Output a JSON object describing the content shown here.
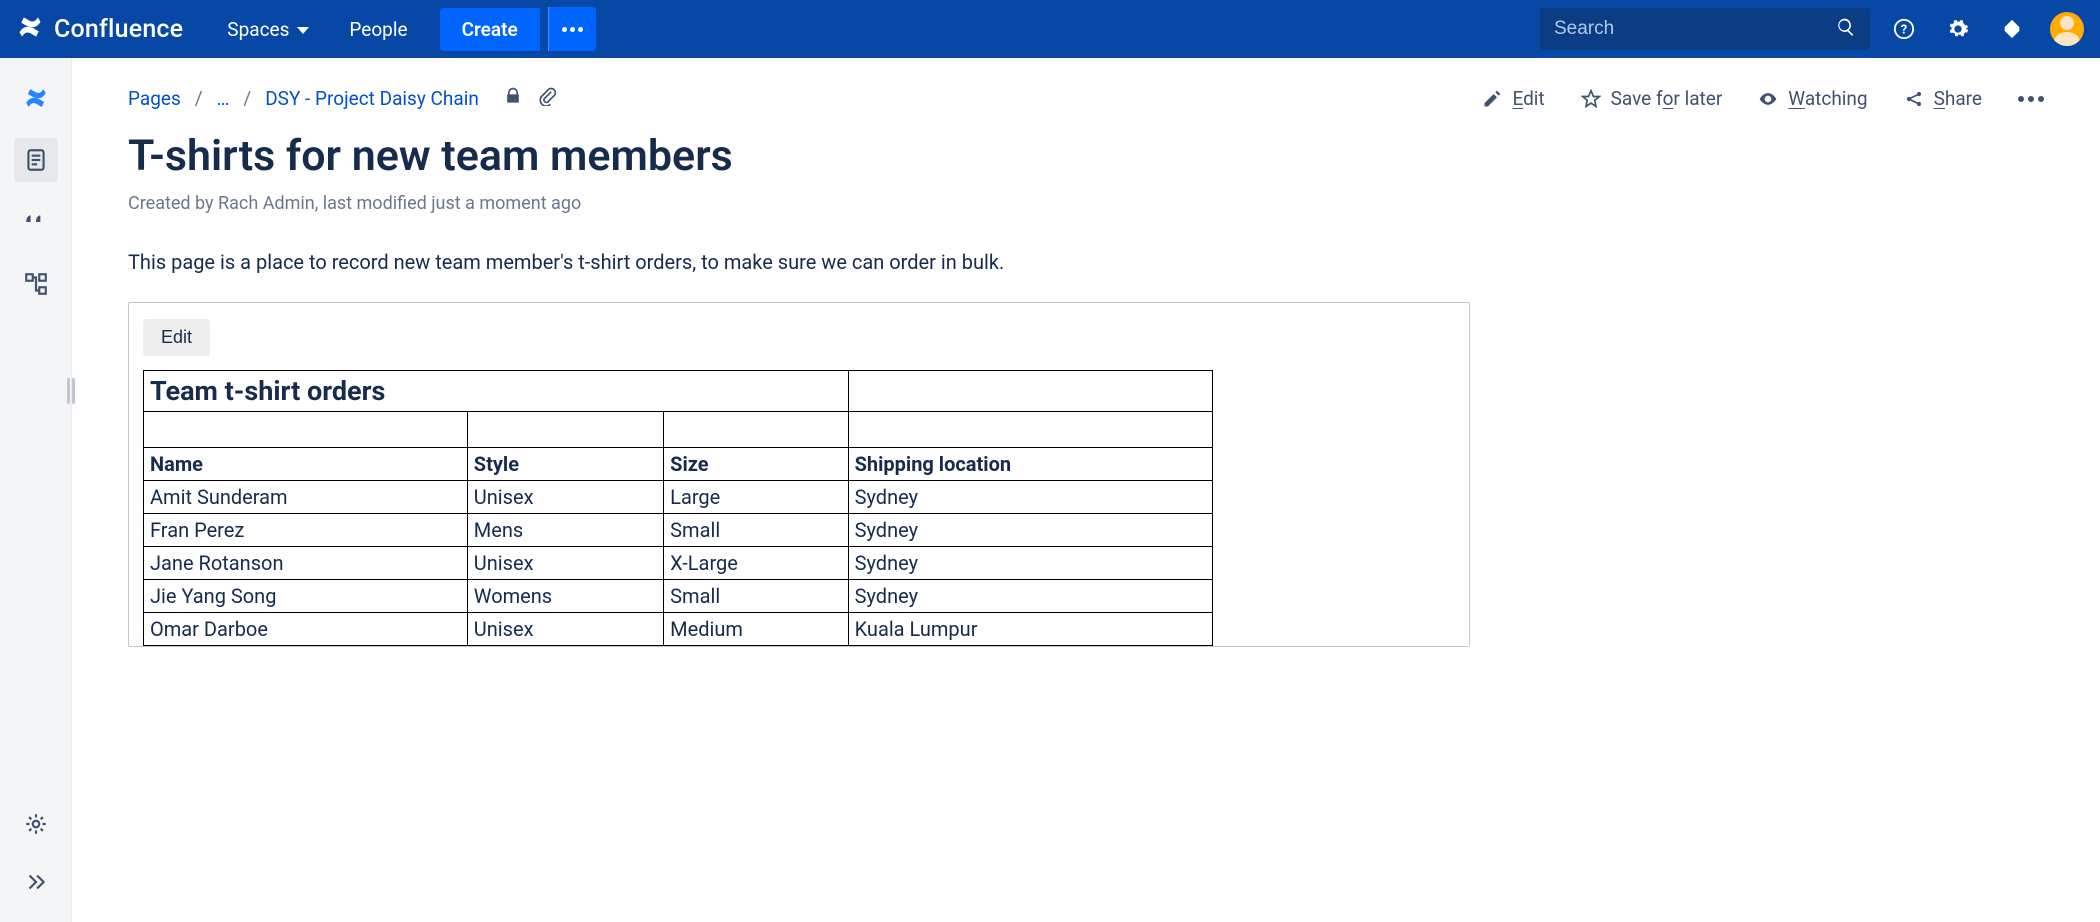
{
  "nav": {
    "brand": "Confluence",
    "spaces": "Spaces",
    "people": "People",
    "create": "Create",
    "search_placeholder": "Search"
  },
  "breadcrumb": {
    "pages": "Pages",
    "ellipsis": "…",
    "parent": "DSY - Project Daisy Chain"
  },
  "actions": {
    "edit": "Edit",
    "edit_u": "E",
    "save": "Save for later",
    "save_pre": "Save f",
    "save_u": "o",
    "save_post": "r later",
    "watch": "Watching",
    "watch_u": "W",
    "watch_rest": "atching",
    "share": "Share",
    "share_u": "S",
    "share_rest": "hare"
  },
  "page": {
    "title": "T-shirts for new team members",
    "meta": "Created by Rach Admin, last modified just a moment ago",
    "intro": "This page is a place to record new team member's t-shirt orders, to make sure we can order in bulk."
  },
  "embed": {
    "edit": "Edit",
    "table_title": "Team t-shirt orders",
    "columns": [
      "Name",
      "Style",
      "Size",
      "Shipping location"
    ],
    "rows": [
      [
        "Amit Sunderam",
        "Unisex",
        "Large",
        "Sydney"
      ],
      [
        "Fran Perez",
        "Mens",
        "Small",
        "Sydney"
      ],
      [
        "Jane Rotanson",
        "Unisex",
        "X-Large",
        "Sydney"
      ],
      [
        "Jie Yang Song",
        "Womens",
        "Small",
        "Sydney"
      ],
      [
        "Omar Darboe",
        "Unisex",
        "Medium",
        "Kuala Lumpur"
      ]
    ]
  }
}
